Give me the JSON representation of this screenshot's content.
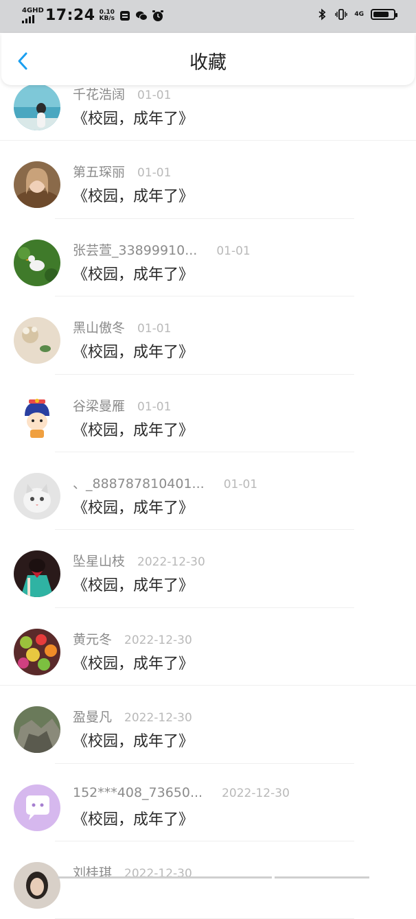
{
  "status_bar": {
    "network": "4GHD",
    "time": "17:24",
    "speed_value": "0.10",
    "speed_unit": "KB/s",
    "network_right": "4G",
    "battery_level": 0.78
  },
  "header": {
    "title": "收藏",
    "back_icon": "chevron-left-icon",
    "accent_color": "#1a9ff0"
  },
  "items": [
    {
      "name": "千花浩阔",
      "date": "01-01",
      "title": "《校园，成年了》",
      "avatar": "beach"
    },
    {
      "name": "第五琛丽",
      "date": "01-01",
      "title": "《校园，成年了》",
      "avatar": "woman-fur"
    },
    {
      "name": "张芸萱_33899910...",
      "date": "01-01",
      "title": "《校园，成年了》",
      "avatar": "goose-grass"
    },
    {
      "name": "黑山傲冬",
      "date": "01-01",
      "title": "《校园，成年了》",
      "avatar": "flowers-pale"
    },
    {
      "name": "谷梁曼雁",
      "date": "01-01",
      "title": "《校园，成年了》",
      "avatar": "cartoon-boy"
    },
    {
      "name": "、_888787810401...",
      "date": "01-01",
      "title": "《校园，成年了》",
      "avatar": "kitten"
    },
    {
      "name": "坠星山枝",
      "date": "2022-12-30",
      "title": "《校园，成年了》",
      "avatar": "anime-girl"
    },
    {
      "name": "黄元冬",
      "date": "2022-12-30",
      "title": "《校园，成年了》",
      "avatar": "fruits"
    },
    {
      "name": "盈曼凡",
      "date": "2022-12-30",
      "title": "《校园，成年了》",
      "avatar": "rocks"
    },
    {
      "name": "152***408_73650...",
      "date": "2022-12-30",
      "title": "《校园，成年了》",
      "avatar": "chat-bubble"
    },
    {
      "name": "刘桂琪",
      "date": "2022-12-30",
      "title": "",
      "avatar": "person-dark"
    }
  ]
}
